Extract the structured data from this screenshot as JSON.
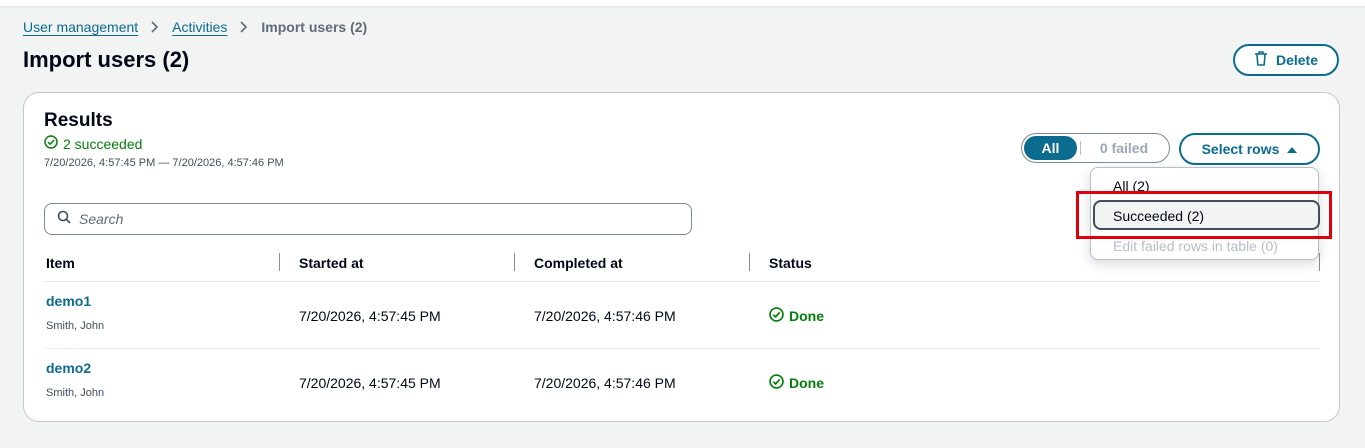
{
  "breadcrumb": {
    "items": [
      "User management",
      "Activities"
    ],
    "current": "Import users (2)"
  },
  "header": {
    "title": "Import users (2)",
    "delete_label": "Delete"
  },
  "results": {
    "title": "Results",
    "succeeded": "2 succeeded",
    "time_range": "7/20/2026, 4:57:45 PM — 7/20/2026, 4:57:46 PM"
  },
  "filter": {
    "all_label": "All",
    "failed_label": "0 failed",
    "select_rows_label": "Select rows"
  },
  "search": {
    "placeholder": "Search"
  },
  "table": {
    "columns": [
      "Item",
      "Started at",
      "Completed at",
      "Status"
    ],
    "rows": [
      {
        "item": "demo1",
        "sub": "Smith, John",
        "started": "7/20/2026, 4:57:45 PM",
        "completed": "7/20/2026, 4:57:46 PM",
        "status": "Done"
      },
      {
        "item": "demo2",
        "sub": "Smith, John",
        "started": "7/20/2026, 4:57:45 PM",
        "completed": "7/20/2026, 4:57:46 PM",
        "status": "Done"
      }
    ]
  },
  "dropdown": {
    "items": [
      "All (2)",
      "Succeeded (2)",
      "Edit failed rows in table (0)"
    ]
  },
  "colors": {
    "accent": "#0b6c8f",
    "success": "#037f0c",
    "highlight": "#e0000b"
  }
}
